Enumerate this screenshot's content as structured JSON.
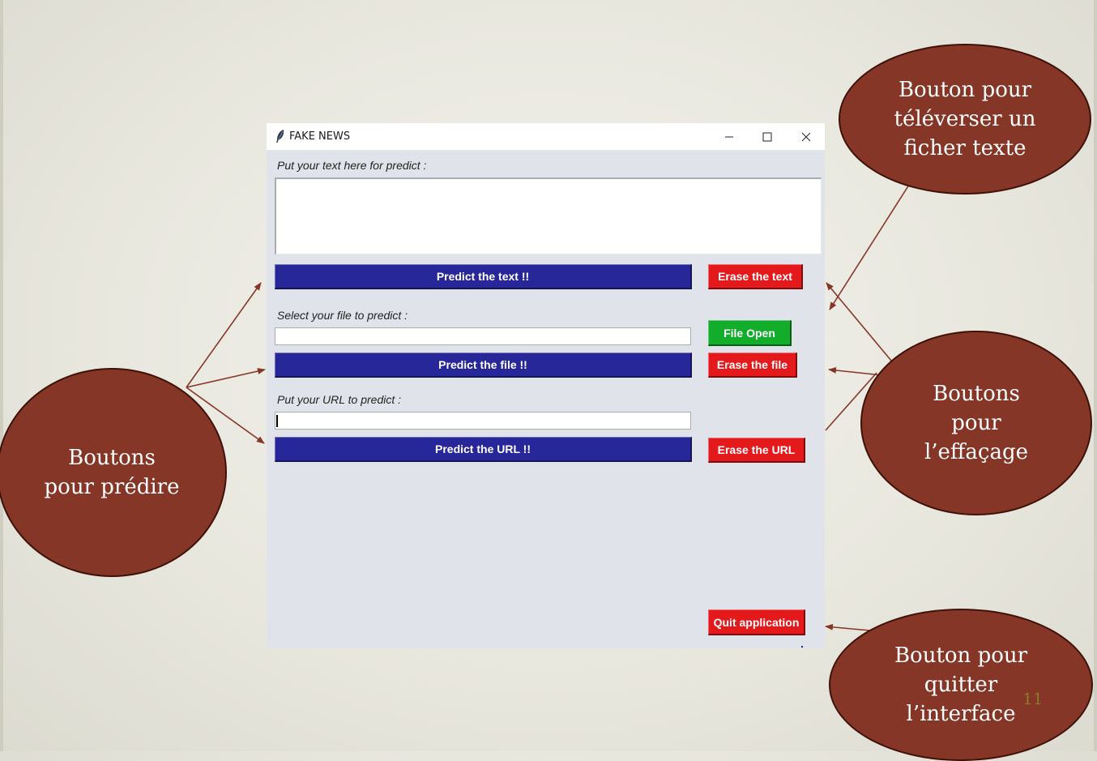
{
  "window": {
    "title": "FAKE NEWS",
    "controls": {
      "minimize": "minimize-icon",
      "maximize": "maximize-icon",
      "close": "close-icon"
    }
  },
  "form": {
    "text_label": "Put your text here for predict :",
    "text_value": "",
    "predict_text_label": "Predict the text !!",
    "erase_text_label": "Erase the text",
    "file_label": "Select your file to predict :",
    "file_value": "",
    "file_open_label": "File Open",
    "predict_file_label": "Predict the file !!",
    "erase_file_label": "Erase the file",
    "url_label": "Put your URL to predict :",
    "url_value": "",
    "predict_url_label": "Predict the URL !!",
    "erase_url_label": "Erase the URL",
    "quit_label": "Quit application"
  },
  "colors": {
    "predict_button": "#27279a",
    "erase_button": "#e3191b",
    "file_open_button": "#12ad2b",
    "callout_bubble": "#853626",
    "arrow": "#853626"
  },
  "callouts": {
    "upload": "Bouton pour\ntéléverser un\nficher texte",
    "predict": "Boutons\npour prédire",
    "erase": "Boutons\npour\nl’effaçage",
    "quit": "Bouton pour\nquitter\nl’interface"
  },
  "slide": {
    "page_number": "11"
  }
}
